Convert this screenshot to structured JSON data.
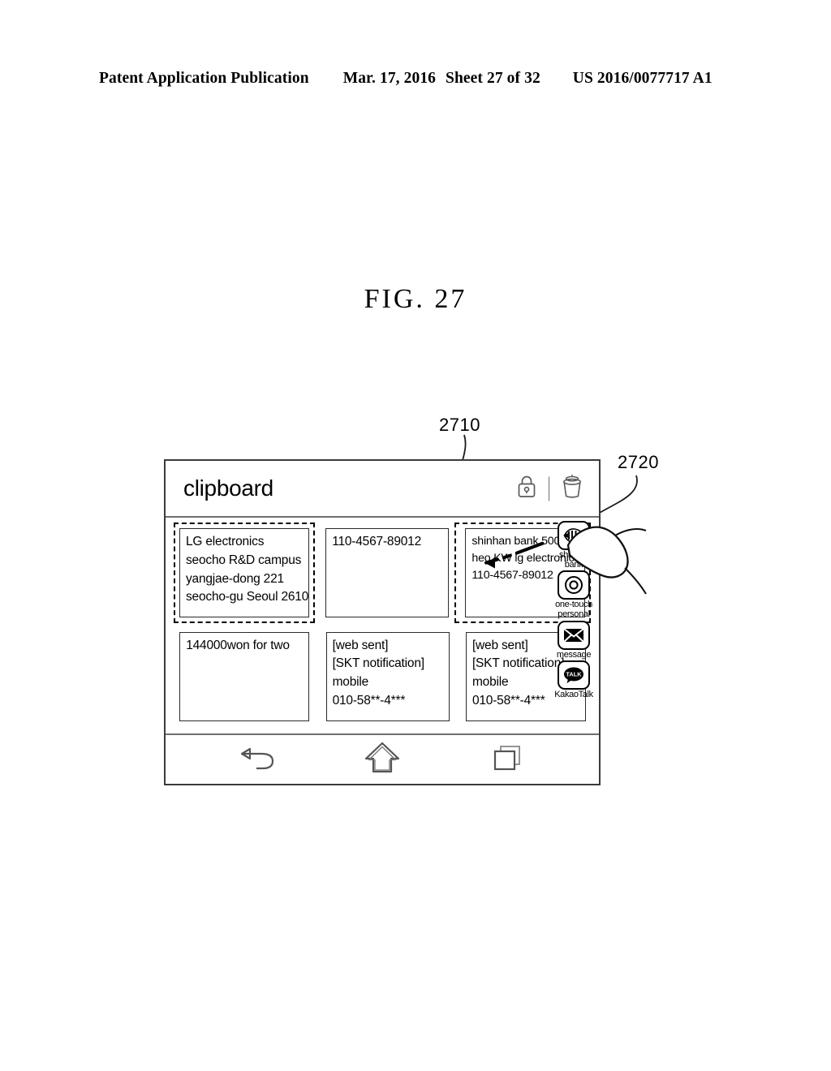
{
  "page_header": {
    "publication": "Patent Application Publication",
    "date": "Mar. 17, 2016",
    "sheet": "Sheet 27 of 32",
    "document_number": "US 2016/0077717 A1"
  },
  "figure": {
    "caption": "FIG. 27",
    "reference_numerals": [
      {
        "id": "2710",
        "label": "2710"
      },
      {
        "id": "2720",
        "label": "2720"
      }
    ]
  },
  "device": {
    "titlebar": {
      "app_title": "clipboard",
      "lock_icon": "lock-icon",
      "trash_icon": "trash-icon"
    },
    "clipboard_cards": [
      {
        "id": "card-1",
        "selected": true,
        "lines": [
          "LG electronics",
          "seocho R&D campus",
          "yangjae-dong 221",
          "seocho-gu Seoul 2610"
        ]
      },
      {
        "id": "card-2",
        "selected": false,
        "lines": [
          "110-4567-89012"
        ]
      },
      {
        "id": "card-3",
        "selected": true,
        "lines": [
          "shinhan bank 50000won",
          "heo.KW lg electronics",
          "110-4567-89012"
        ]
      },
      {
        "id": "card-4",
        "selected": false,
        "lines": [
          "144000won for two"
        ]
      },
      {
        "id": "card-5",
        "selected": false,
        "lines": [
          "[web sent]",
          "[SKT notification]",
          "mobile",
          "010-58**-4***"
        ]
      },
      {
        "id": "card-6",
        "selected": false,
        "lines": [
          "[web sent]",
          "[SKT notification]",
          "mobile",
          "010-58**-4***"
        ]
      }
    ],
    "app_rail": [
      {
        "id": "shinhan-bank",
        "label": "shinhan\nbank",
        "label_line1": "shinhan",
        "label_line2": "bank",
        "icon": "shinhan-bank-icon"
      },
      {
        "id": "one-touch-personal",
        "label_line1": "one-touch",
        "label_line2": "personal",
        "icon": "one-touch-personal-icon"
      },
      {
        "id": "message",
        "label_line1": "message",
        "label_line2": "",
        "icon": "message-envelope-icon"
      },
      {
        "id": "kakaotalk",
        "label_line1": "KakaoTalk",
        "label_line2": "",
        "icon": "kakaotalk-icon"
      }
    ],
    "navbar": [
      {
        "id": "back",
        "icon": "back-arrow-icon"
      },
      {
        "id": "home",
        "icon": "home-up-arrow-icon"
      },
      {
        "id": "recents",
        "icon": "recent-apps-icon"
      }
    ]
  },
  "annotations": {
    "drag_gesture": "drag-arrow",
    "touch_gesture": "finger-touch-pointer"
  }
}
